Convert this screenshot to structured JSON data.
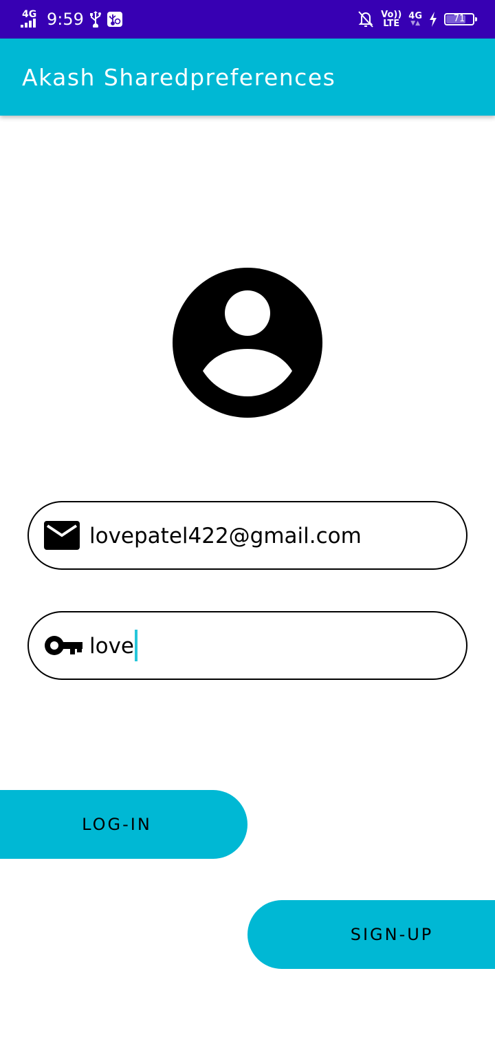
{
  "status_bar": {
    "network_left": "4G",
    "time": "9:59",
    "volte_top": "Vo))",
    "volte_bottom": "LTE",
    "network_right": "4G",
    "battery_level": "71",
    "background_color": "#3700b3"
  },
  "app_bar": {
    "title": "Akash Sharedpreferences",
    "background_color": "#00b8d4"
  },
  "avatar": {
    "icon": "account-circle-icon"
  },
  "email_field": {
    "icon": "email-icon",
    "value": "lovepatel422@gmail.com"
  },
  "password_field": {
    "icon": "key-icon",
    "value": "love"
  },
  "buttons": {
    "login_label": "LOG-IN",
    "signup_label": "SIGN-UP",
    "color": "#00b8d4"
  }
}
